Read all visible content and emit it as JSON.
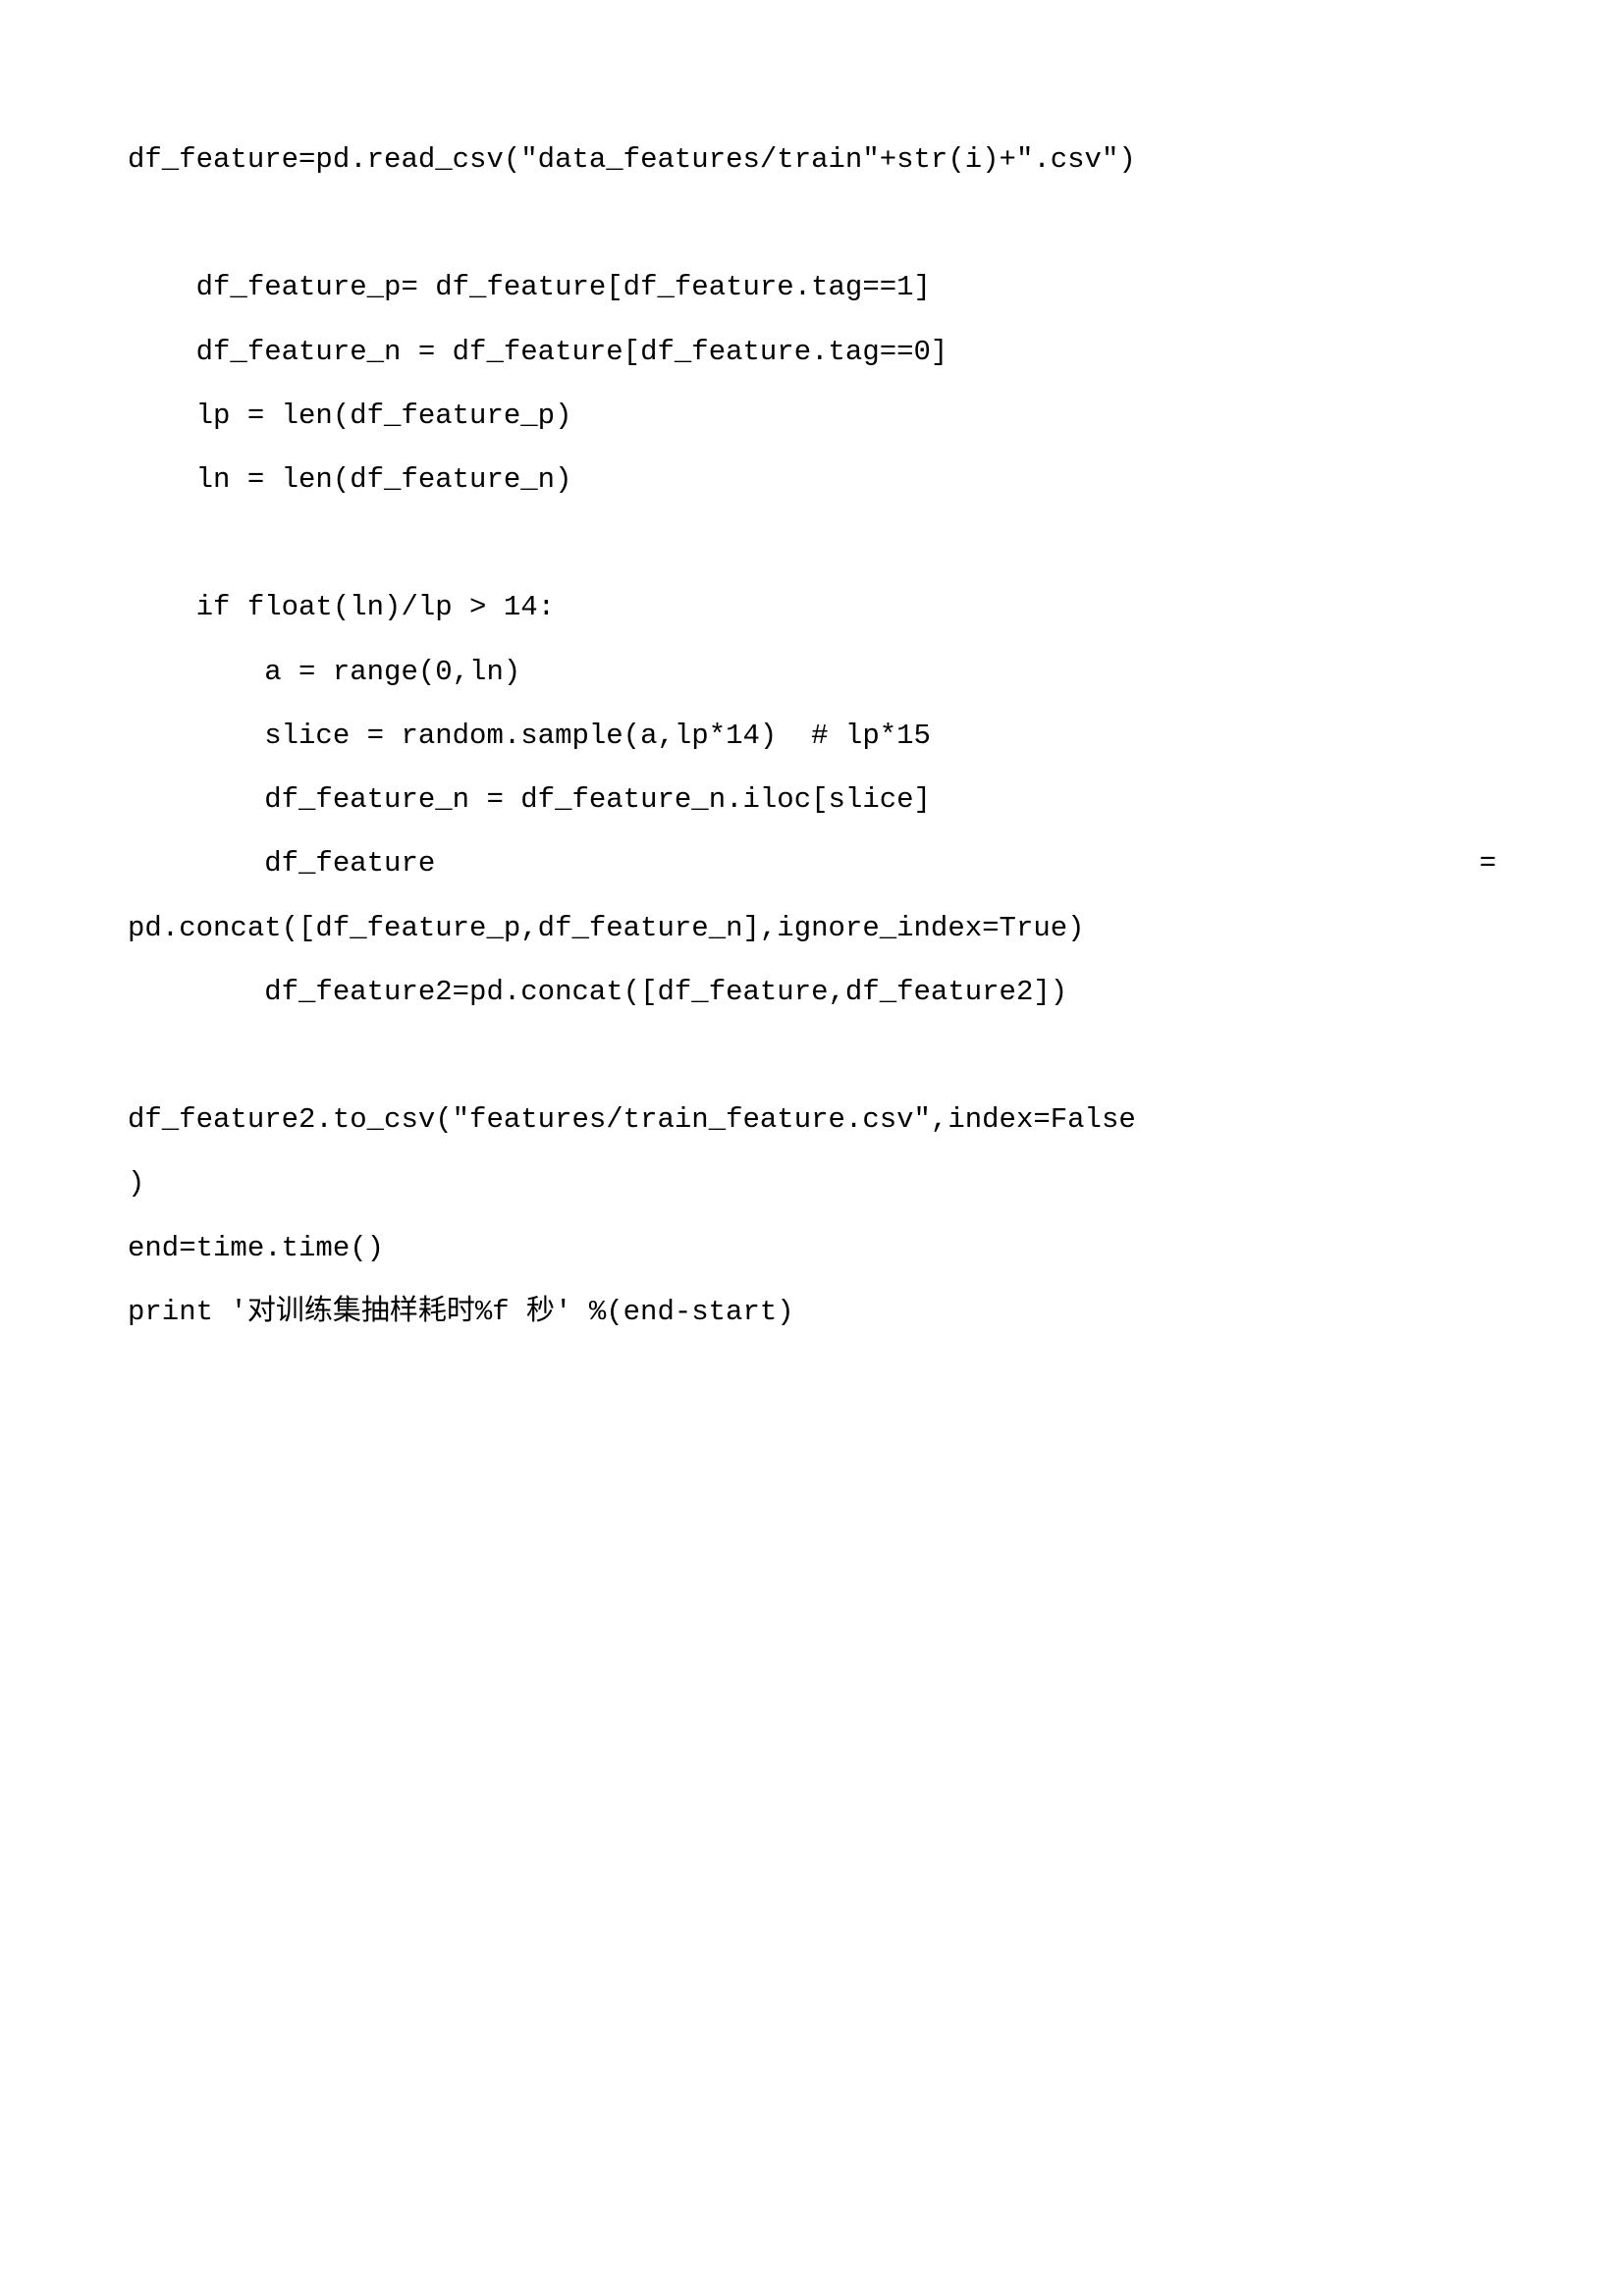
{
  "code": {
    "line1": "df_feature=pd.read_csv(\"data_features/train\"+str(i)+\".csv\")",
    "line2": "    df_feature_p= df_feature[df_feature.tag==1]",
    "line3": "    df_feature_n = df_feature[df_feature.tag==0]",
    "line4": "    lp = len(df_feature_p)",
    "line5": "    ln = len(df_feature_n)",
    "line6": "    if float(ln)/lp > 14:",
    "line7": "        a = range(0,ln)",
    "line8": "        slice = random.sample(a,lp*14)  # lp*15",
    "line9": "        df_feature_n = df_feature_n.iloc[slice]",
    "line10_left": "        df_feature",
    "line10_right": "=",
    "line11": "pd.concat([df_feature_p,df_feature_n],ignore_index=True)",
    "line12": "        df_feature2=pd.concat([df_feature,df_feature2])",
    "line13": "df_feature2.to_csv(\"features/train_feature.csv\",index=False",
    "line14": ")",
    "line15": "end=time.time()",
    "line16": "print '对训练集抽样耗时%f 秒' %(end-start)"
  }
}
